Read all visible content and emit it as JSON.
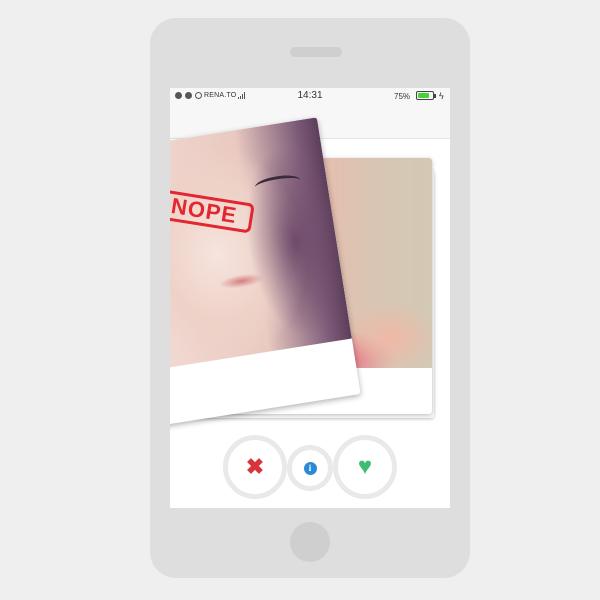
{
  "status_bar": {
    "carrier": "RENA.TO",
    "time": "14:31",
    "battery_percent_label": "75%",
    "battery_level": 0.75,
    "battery_color": "#46d33a",
    "signal_dots": 3,
    "signal_dots_filled": 2
  },
  "card": {
    "stamp_text": "NOPE",
    "stamp_color": "#e3262f"
  },
  "actions": {
    "nope_icon": "x-icon",
    "info_icon": "info-icon",
    "like_icon": "heart-icon",
    "nope_color": "#d6353b",
    "info_color": "#2b8ad8",
    "like_color": "#3dbc74"
  }
}
